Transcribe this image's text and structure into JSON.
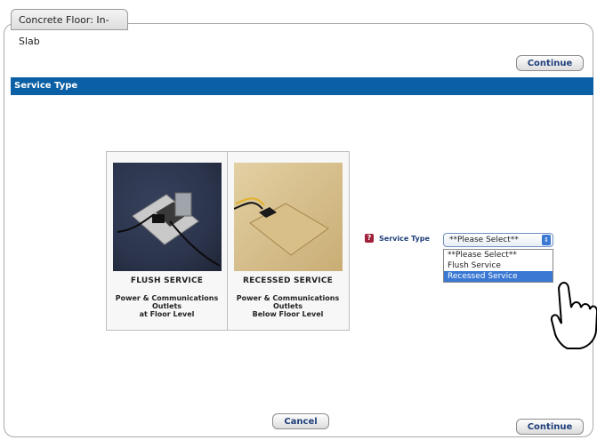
{
  "tab_title": "Concrete Floor: In-Slab",
  "buttons": {
    "continue_top": "Continue",
    "continue_bottom": "Continue",
    "cancel": "Cancel"
  },
  "section_header": "Service Type",
  "choices": [
    {
      "title": "FLUSH SERVICE",
      "lines": [
        "Power & Communications",
        "Outlets",
        "at Floor Level"
      ]
    },
    {
      "title": "RECESSED SERVICE",
      "lines": [
        "Power & Communications",
        "Outlets",
        "Below Floor Level"
      ]
    }
  ],
  "field": {
    "label": "Service Type",
    "selected": "**Please Select**",
    "options": [
      "**Please Select**",
      "Flush Service",
      "Recessed Service"
    ],
    "highlighted_option": "Recessed Service"
  },
  "colors": {
    "header_bar": "#0b5fa5",
    "highlight": "#3a78d3",
    "help_icon": "#a0213a"
  }
}
